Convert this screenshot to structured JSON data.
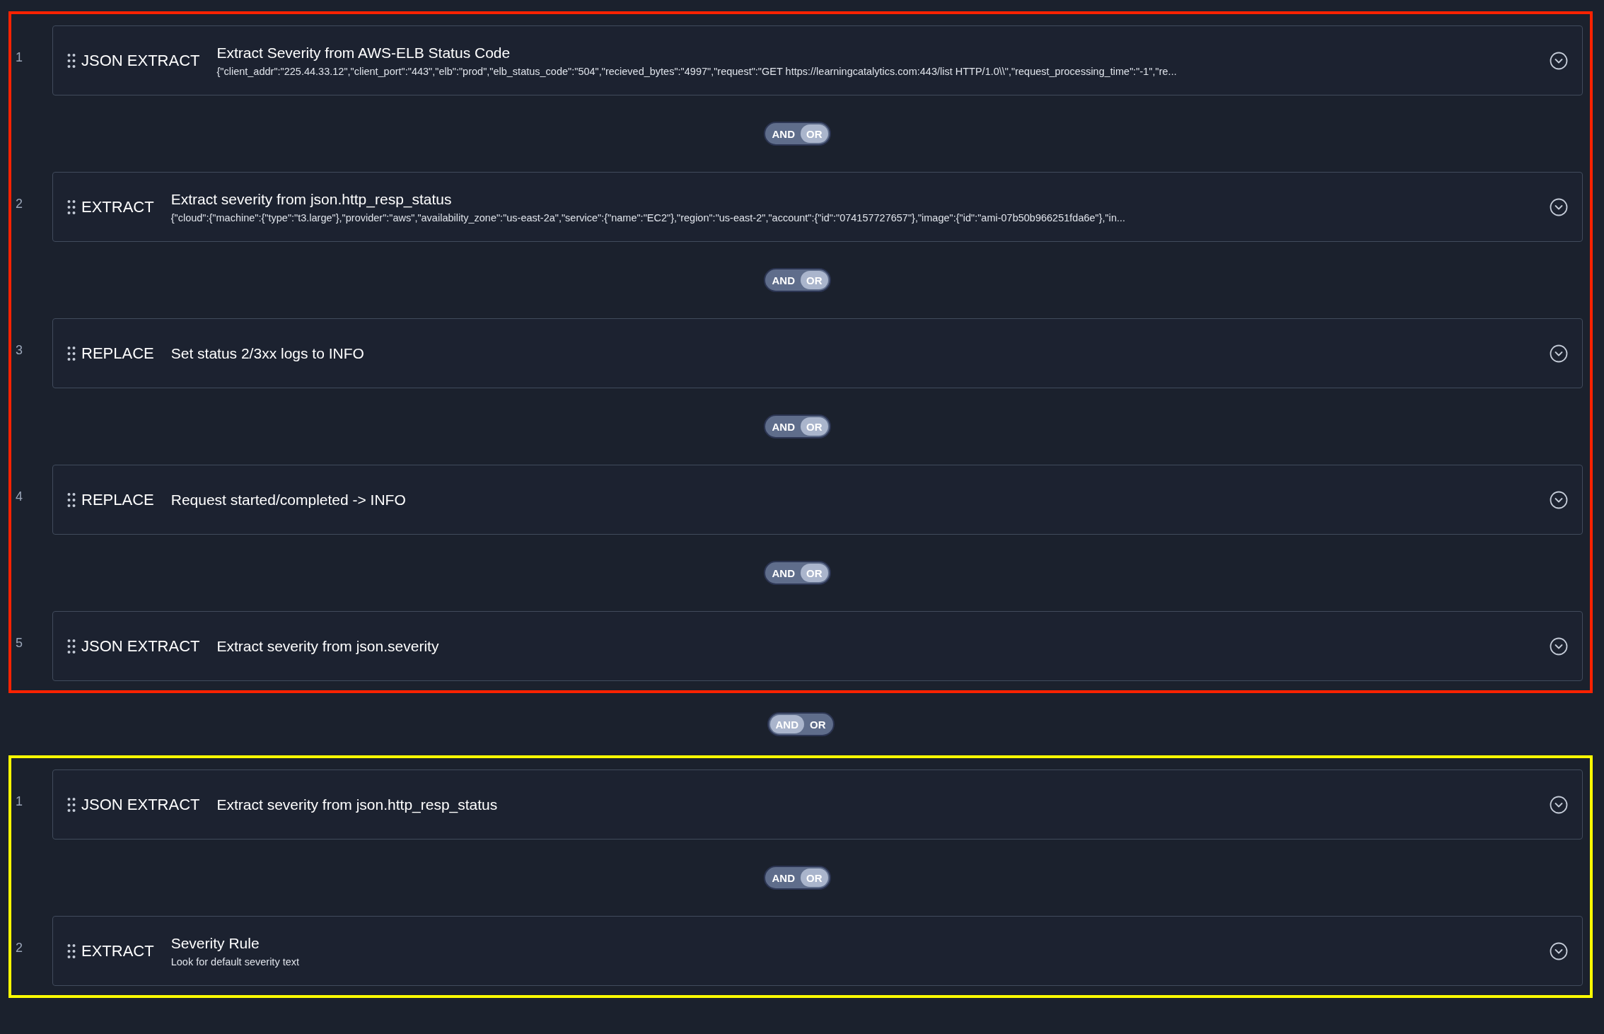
{
  "groups": [
    {
      "color": "#ff2200",
      "rules": [
        {
          "number": "1",
          "type": "JSON EXTRACT",
          "title": "Extract Severity from AWS-ELB Status Code",
          "description": "{\"client_addr\":\"225.44.33.12\",\"client_port\":\"443\",\"elb\":\"prod\",\"elb_status_code\":\"504\",\"recieved_bytes\":\"4997\",\"request\":\"GET https://learningcatalytics.com:443/list HTTP/1.0\\\\\",\"request_processing_time\":\"-1\",\"re..."
        },
        {
          "number": "2",
          "type": "EXTRACT",
          "title": "Extract severity from json.http_resp_status",
          "description": "{\"cloud\":{\"machine\":{\"type\":\"t3.large\"},\"provider\":\"aws\",\"availability_zone\":\"us-east-2a\",\"service\":{\"name\":\"EC2\"},\"region\":\"us-east-2\",\"account\":{\"id\":\"074157727657\"},\"image\":{\"id\":\"ami-07b50b966251fda6e\"},\"in..."
        },
        {
          "number": "3",
          "type": "REPLACE",
          "title": "Set status 2/3xx logs to INFO"
        },
        {
          "number": "4",
          "type": "REPLACE",
          "title": "Request started/completed -> INFO"
        },
        {
          "number": "5",
          "type": "JSON EXTRACT",
          "title": "Extract severity from json.severity"
        }
      ],
      "connectors": [
        {
          "options": [
            {
              "label": "AND",
              "selected": false
            },
            {
              "label": "OR",
              "selected": true
            }
          ]
        },
        {
          "options": [
            {
              "label": "AND",
              "selected": false
            },
            {
              "label": "OR",
              "selected": true
            }
          ]
        },
        {
          "options": [
            {
              "label": "AND",
              "selected": false
            },
            {
              "label": "OR",
              "selected": true
            }
          ]
        },
        {
          "options": [
            {
              "label": "AND",
              "selected": false
            },
            {
              "label": "OR",
              "selected": true
            }
          ]
        }
      ]
    },
    {
      "color": "#ffff00",
      "rules": [
        {
          "number": "1",
          "type": "JSON EXTRACT",
          "title": "Extract severity from json.http_resp_status"
        },
        {
          "number": "2",
          "type": "EXTRACT",
          "title": "Severity Rule",
          "description": "Look for default severity text"
        }
      ],
      "connectors": [
        {
          "options": [
            {
              "label": "AND",
              "selected": false
            },
            {
              "label": "OR",
              "selected": true
            }
          ]
        }
      ]
    }
  ],
  "group_connectors": [
    {
      "options": [
        {
          "label": "AND",
          "selected": true
        },
        {
          "label": "OR",
          "selected": false
        }
      ]
    }
  ]
}
